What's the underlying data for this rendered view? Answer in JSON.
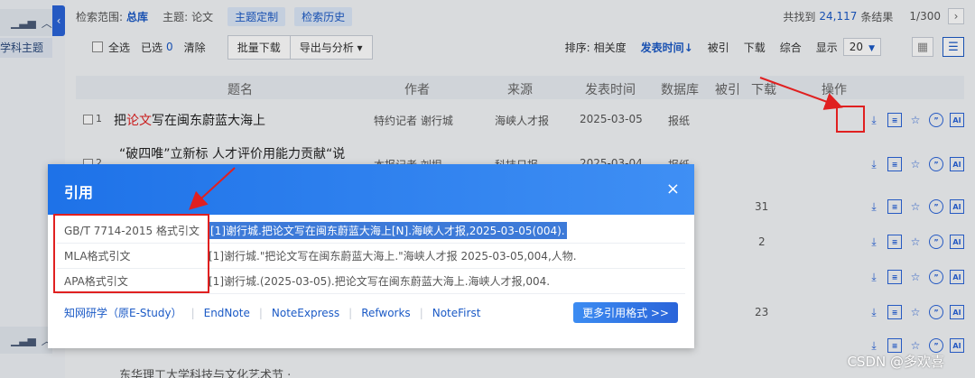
{
  "sidebar": {
    "panel1_label": "",
    "panel1_sub": "学科主题",
    "panel2_label": "",
    "collapse_glyph": "‹"
  },
  "topbar": {
    "scope_label": "检索范围:",
    "scope_value": "总库",
    "subject_label": "主题:",
    "subject_value": "论文",
    "btn_custom": "主题定制",
    "btn_history": "检索历史",
    "found_label": "共找到",
    "found_count": "24,117",
    "found_suffix": "条结果",
    "page": "1/300",
    "next_glyph": "›"
  },
  "toolbar": {
    "select_all": "全选",
    "selected_label": "已选",
    "selected_count": "0",
    "clear": "清除",
    "batch_download": "批量下载",
    "export": "导出与分析 ▾",
    "sort_label": "排序:",
    "sort_items": [
      "相关度",
      "发表时间↓",
      "被引",
      "下载",
      "综合"
    ],
    "display_label": "显示",
    "display_value": "20"
  },
  "table": {
    "headers": [
      "题名",
      "作者",
      "来源",
      "发表时间",
      "数据库",
      "被引",
      "下载",
      "操作"
    ],
    "rows": [
      {
        "idx": "1",
        "title_pre": "把",
        "title_hl": "论文",
        "title_post": "写在闽东蔚蓝大海上",
        "author": "特约记者 谢行城",
        "source": "海峡人才报",
        "date": "2025-03-05",
        "db": "报纸"
      },
      {
        "idx": "2",
        "title_pre": "“破四唯”立新标 人才评价用能力贡献“说",
        "title_hl": "",
        "title_post": "",
        "author": "本报记者 刘垠",
        "source": "科技日报",
        "date": "2025-03-04",
        "db": "报纸"
      }
    ],
    "counts": [
      "31",
      "2",
      "23"
    ],
    "row_last": "东华理工大学科技与文化艺术节 ·"
  },
  "ops_icons": [
    "download-icon",
    "read-icon",
    "favorite-icon",
    "cite-icon",
    "ai-icon"
  ],
  "dialog": {
    "title": "引用",
    "close": "×",
    "rows": [
      {
        "label": "GB/T 7714-2015 格式引文",
        "text": "[1]谢行城.把论文写在闽东蔚蓝大海上[N].海峡人才报,2025-03-05(004)."
      },
      {
        "label": "MLA格式引文",
        "text": "[1]谢行城.\"把论文写在闽东蔚蓝大海上.\"海峡人才报 2025-03-05,004,人物."
      },
      {
        "label": "APA格式引文",
        "text": "[1]谢行城.(2025-03-05).把论文写在闽东蔚蓝大海上.海峡人才报,004."
      }
    ],
    "footer_links": [
      "知网研学（原E-Study）",
      "EndNote",
      "NoteExpress",
      "Refworks",
      "NoteFirst"
    ],
    "more_button": "更多引用格式 >>"
  },
  "watermark": "CSDN @多欢喜",
  "colors": {
    "accent": "#1b5ac6",
    "annotation": "#e02020",
    "dialog_header": "#1e72e8"
  }
}
